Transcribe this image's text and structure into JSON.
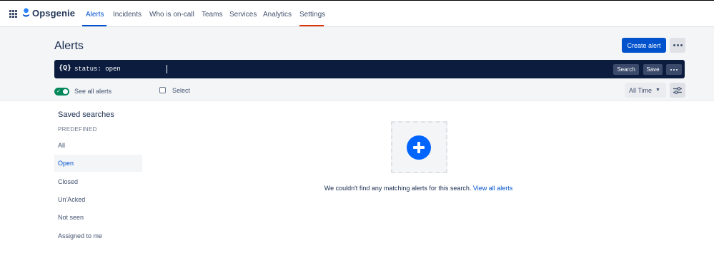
{
  "app": {
    "name": "Opsgenie"
  },
  "nav": {
    "items": [
      {
        "label": "Alerts"
      },
      {
        "label": "Incidents"
      },
      {
        "label": "Who is on-call"
      },
      {
        "label": "Teams"
      },
      {
        "label": "Services"
      },
      {
        "label": "Analytics"
      },
      {
        "label": "Settings"
      }
    ],
    "active": "Alerts",
    "highlighted": "Settings"
  },
  "page": {
    "title": "Alerts",
    "create_label": "Create alert"
  },
  "query": {
    "icon": "{Q}",
    "text": "status: open",
    "help": "?",
    "search_label": "Search",
    "save_label": "Save"
  },
  "toolbar": {
    "see_all_label": "See all alerts",
    "see_all_on": true,
    "select_label": "Select",
    "time_label": "All Time"
  },
  "sidebar": {
    "title": "Saved searches",
    "section": "PREDEFINED",
    "items": [
      {
        "label": "All"
      },
      {
        "label": "Open"
      },
      {
        "label": "Closed"
      },
      {
        "label": "Un'Acked"
      },
      {
        "label": "Not seen"
      },
      {
        "label": "Assigned to me"
      }
    ],
    "active": "Open"
  },
  "empty": {
    "message": "We couldn't find any matching alerts for this search.",
    "link": "View all alerts"
  },
  "colors": {
    "primary": "#0052cc",
    "query_bar": "#0b1c3f",
    "toggle_on": "#00875a",
    "settings_underline": "#de350b",
    "plus": "#0065ff"
  }
}
